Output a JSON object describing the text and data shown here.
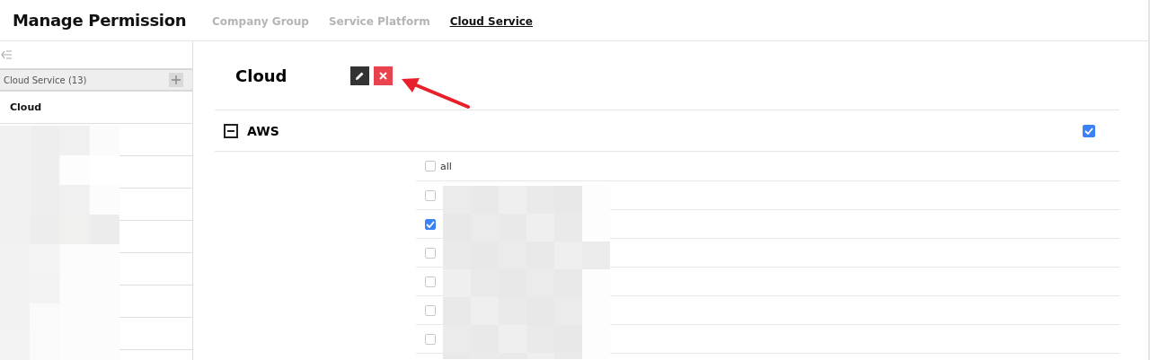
{
  "header": {
    "title": "Manage Permission",
    "tabs": [
      {
        "label": "Company Group",
        "selected": false
      },
      {
        "label": "Service Platform",
        "selected": false
      },
      {
        "label": "Cloud Service",
        "selected": true
      }
    ]
  },
  "sidebar": {
    "group": {
      "label": "Cloud Service (13)"
    },
    "items": [
      {
        "label": "Cloud",
        "selected": true
      },
      {
        "selected": false
      },
      {
        "selected": false
      },
      {
        "selected": false
      },
      {
        "selected": false
      },
      {
        "selected": false
      },
      {
        "selected": false
      },
      {
        "selected": false
      }
    ]
  },
  "detail": {
    "title": "Cloud",
    "sections": [
      {
        "label": "AWS",
        "expanded": true,
        "checked": true,
        "options": [
          {
            "label": "all",
            "checked": false
          },
          {
            "checked": false
          },
          {
            "checked": true
          },
          {
            "checked": false
          },
          {
            "checked": false
          },
          {
            "checked": false
          },
          {
            "checked": false
          }
        ]
      }
    ]
  }
}
